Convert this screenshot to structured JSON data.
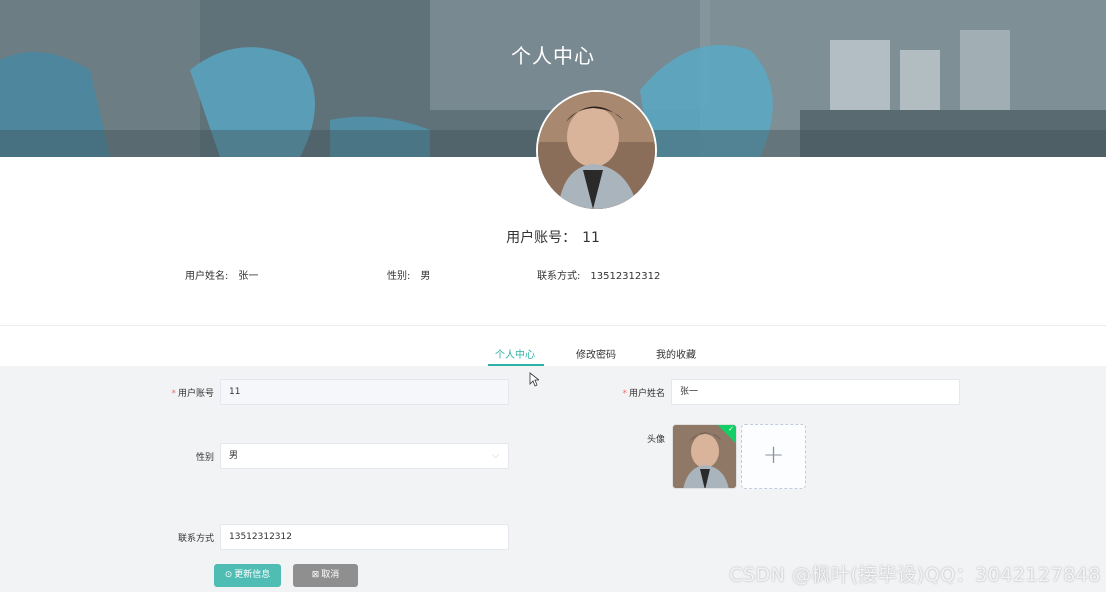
{
  "banner": {
    "title": "个人中心"
  },
  "profile": {
    "account_label": "用户账号：",
    "account_value": "11",
    "name_label": "用户姓名:",
    "name_value": "张一",
    "gender_label": "性别:",
    "gender_value": "男",
    "phone_label": "联系方式:",
    "phone_value": "13512312312"
  },
  "tabs": [
    {
      "label": "个人中心",
      "active": true
    },
    {
      "label": "修改密码",
      "active": false
    },
    {
      "label": "我的收藏",
      "active": false
    }
  ],
  "form": {
    "account": {
      "label": "用户账号",
      "required": "*",
      "value": "11"
    },
    "name": {
      "label": "用户姓名",
      "required": "*",
      "value": "张一"
    },
    "gender": {
      "label": "性别",
      "value": "男"
    },
    "avatar": {
      "label": "头像"
    },
    "phone": {
      "label": "联系方式",
      "value": "13512312312"
    },
    "upload_add_glyph": "+"
  },
  "buttons": {
    "update_icon": "⊙",
    "update_label": "更新信息",
    "cancel_icon": "⊠",
    "cancel_label": "取消"
  },
  "watermark": "CSDN @枫叶(接毕设)QQ：3042127848",
  "colors": {
    "accent": "#2fb1a6",
    "primary_button": "#4fbdb4",
    "cancel_button": "#8f8f8f",
    "required": "#f56c6c",
    "upload_success": "#13ce66"
  }
}
